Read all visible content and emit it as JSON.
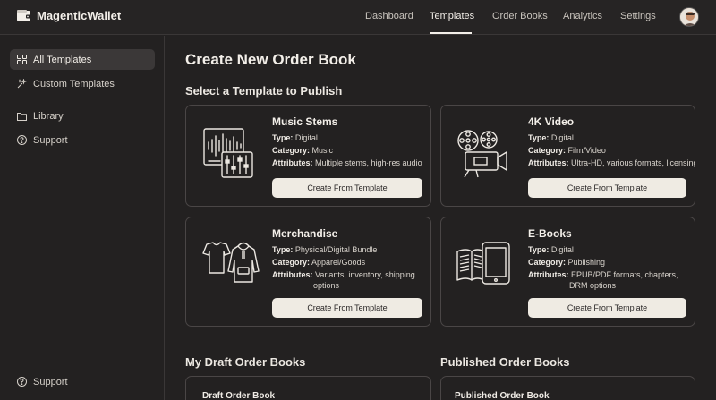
{
  "app": {
    "name": "MagenticWallet"
  },
  "nav": {
    "items": [
      {
        "label": "Dashboard"
      },
      {
        "label": "Templates"
      },
      {
        "label": "Order Books"
      },
      {
        "label": "Analytics"
      },
      {
        "label": "Settings"
      }
    ],
    "active": "Templates"
  },
  "sidebar": {
    "items": [
      {
        "label": "All Templates",
        "icon": "grid-icon",
        "active": true
      },
      {
        "label": "Custom Templates",
        "icon": "sparkle-icon"
      },
      {
        "label": "Library",
        "icon": "folder-icon"
      },
      {
        "label": "Support",
        "icon": "help-icon"
      }
    ],
    "footer": {
      "label": "Support",
      "icon": "help-icon"
    }
  },
  "page": {
    "title": "Create New Order Book",
    "section_title": "Select a Template to Publish",
    "drafts_title": "My Draft Order Books",
    "published_title": "Published Order Books"
  },
  "templates": [
    {
      "title": "Music Stems",
      "icon": "audio-mixer-icon",
      "type_label": "Type:",
      "type": "Digital",
      "category_label": "Category:",
      "category": "Music",
      "attributes_label": "Attributes:",
      "attributes": "Multiple stems, high-res audio",
      "button": "Create From Template"
    },
    {
      "title": "4K Video",
      "icon": "film-camera-icon",
      "type_label": "Type:",
      "type": "Digital",
      "category_label": "Category:",
      "category": "Film/Video",
      "attributes_label": "Attributes:",
      "attributes": "Ultra-HD, various formats, licensing",
      "button": "Create From Template"
    },
    {
      "title": "Merchandise",
      "icon": "apparel-icon",
      "type_label": "Type:",
      "type": "Physical/Digital Bundle",
      "category_label": "Category:",
      "category": "Apparel/Goods",
      "attributes_label": "Attributes:",
      "attributes": "Variants, inventory, shipping",
      "attributes_cont": "options",
      "button": "Create From Template"
    },
    {
      "title": "E-Books",
      "icon": "book-tablet-icon",
      "type_label": "Type:",
      "type": "Digital",
      "category_label": "Category:",
      "category": "Publishing",
      "attributes_label": "Attributes:",
      "attributes": "EPUB/PDF formats, chapters,",
      "attributes_cont": "DRM options",
      "button": "Create From Template"
    }
  ],
  "drafts": [
    {
      "title": "Draft Order Book"
    }
  ],
  "published": [
    {
      "title": "Published Order Book"
    }
  ],
  "colors": {
    "background": "#232121",
    "accent_button": "#efebe3",
    "border": "#4a4646"
  }
}
